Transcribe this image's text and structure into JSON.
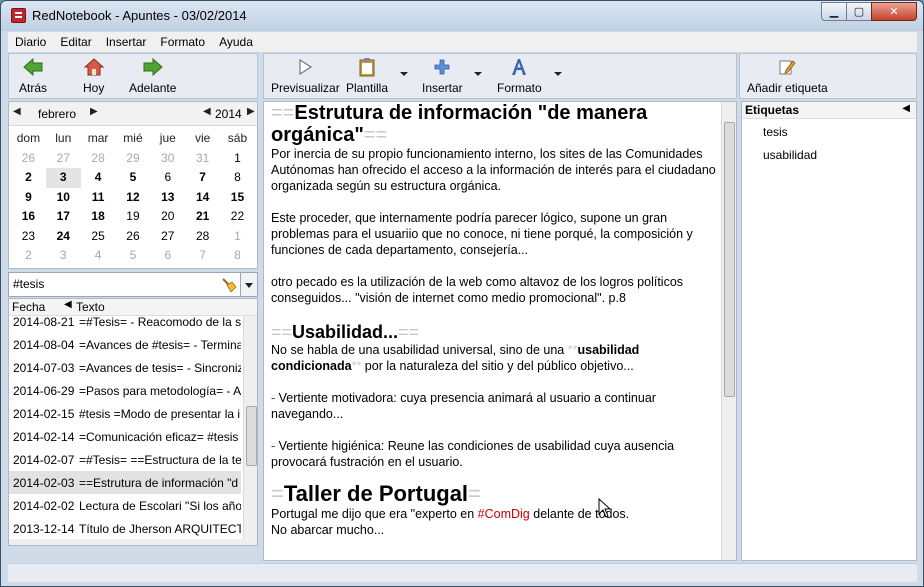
{
  "window": {
    "title": "RedNotebook - Apuntes - 03/02/2014",
    "buttons": {
      "minimize": "▁",
      "maximize": "▢",
      "close": "✕"
    }
  },
  "menu": [
    "Diario",
    "Editar",
    "Insertar",
    "Formato",
    "Ayuda"
  ],
  "nav_toolbar": {
    "back": "Atrás",
    "today": "Hoy",
    "forward": "Adelante"
  },
  "edit_toolbar": {
    "preview": "Previsualizar",
    "template": "Plantilla",
    "insert": "Insertar",
    "format": "Formato"
  },
  "tag_toolbar": {
    "add_tag": "Añadir etiqueta"
  },
  "calendar": {
    "month": "febrero",
    "year": "2014",
    "weekdays": [
      "dom",
      "lun",
      "mar",
      "mié",
      "jue",
      "vie",
      "sáb"
    ],
    "weeks": [
      [
        {
          "d": "26",
          "s": "dim"
        },
        {
          "d": "27",
          "s": "dim"
        },
        {
          "d": "28",
          "s": "dim"
        },
        {
          "d": "29",
          "s": "dim"
        },
        {
          "d": "30",
          "s": "dim"
        },
        {
          "d": "31",
          "s": "dim"
        },
        {
          "d": "1",
          "s": ""
        }
      ],
      [
        {
          "d": "2",
          "s": "bold"
        },
        {
          "d": "3",
          "s": "bold sel"
        },
        {
          "d": "4",
          "s": "bold"
        },
        {
          "d": "5",
          "s": "bold"
        },
        {
          "d": "6",
          "s": ""
        },
        {
          "d": "7",
          "s": "bold"
        },
        {
          "d": "8",
          "s": ""
        }
      ],
      [
        {
          "d": "9",
          "s": "bold"
        },
        {
          "d": "10",
          "s": "bold"
        },
        {
          "d": "11",
          "s": "bold"
        },
        {
          "d": "12",
          "s": "bold"
        },
        {
          "d": "13",
          "s": "bold"
        },
        {
          "d": "14",
          "s": "bold"
        },
        {
          "d": "15",
          "s": "bold"
        }
      ],
      [
        {
          "d": "16",
          "s": "bold"
        },
        {
          "d": "17",
          "s": "bold"
        },
        {
          "d": "18",
          "s": "bold"
        },
        {
          "d": "19",
          "s": ""
        },
        {
          "d": "20",
          "s": ""
        },
        {
          "d": "21",
          "s": "bold"
        },
        {
          "d": "22",
          "s": ""
        }
      ],
      [
        {
          "d": "23",
          "s": ""
        },
        {
          "d": "24",
          "s": "bold"
        },
        {
          "d": "25",
          "s": ""
        },
        {
          "d": "26",
          "s": ""
        },
        {
          "d": "27",
          "s": ""
        },
        {
          "d": "28",
          "s": ""
        },
        {
          "d": "1",
          "s": "dim"
        }
      ],
      [
        {
          "d": "2",
          "s": "dim"
        },
        {
          "d": "3",
          "s": "dim"
        },
        {
          "d": "4",
          "s": "dim"
        },
        {
          "d": "5",
          "s": "dim"
        },
        {
          "d": "6",
          "s": "dim"
        },
        {
          "d": "7",
          "s": "dim"
        },
        {
          "d": "8",
          "s": "dim"
        }
      ]
    ]
  },
  "search": {
    "value": "#tesis"
  },
  "results": {
    "col_date": "Fecha",
    "col_text": "Texto",
    "rows": [
      {
        "date": "2014-08-21",
        "text": "=#Tesis= - Reacomodo de la si"
      },
      {
        "date": "2014-08-04",
        "text": "=Avances de #tesis= - Termina"
      },
      {
        "date": "2014-07-03",
        "text": "=Avances de tesis= - Sincroniz"
      },
      {
        "date": "2014-06-29",
        "text": "=Pasos para metodología= - A"
      },
      {
        "date": "2014-02-15",
        "text": "#tesis =Modo de presentar la ir"
      },
      {
        "date": "2014-02-14",
        "text": "=Comunicación eficaz= #tesis"
      },
      {
        "date": "2014-02-07",
        "text": "=#Tesis= ==Estructura de la te"
      },
      {
        "date": "2014-02-03",
        "text": "==Estrutura de información \"d"
      },
      {
        "date": "2014-02-02",
        "text": "Lectura de Escolari  \"Si los años"
      },
      {
        "date": "2013-12-14",
        "text": "Título de Jherson  ARQUITECTU"
      }
    ],
    "selected_index": 7
  },
  "editor": {
    "h1a_mark": "==",
    "h1a": "Estrutura de información \"de manera orgánica\"",
    "p1": "Por inercia de su propio funcionamiento interno, los sites de las Comunidades Autónomas han ofrecido el acceso a la información de interés para el ciudadano organizada según su estructura orgánica.",
    "p2": "Este proceder, que internamente podría parecer lógico, supone un gran problemas para el usuariio que no conoce, ni tiene porqué, la composición y funciones de cada departamento, consejería...",
    "p3": "otro pecado es la utilización de la web como altavoz de los logros políticos conseguidos... \"visión de internet como medio promocional\". p.8",
    "h2_mark": "==",
    "h2": "Usabilidad...",
    "p4_a": "No se habla de una usabilidad universal, sino de una ",
    "p4_mark": "**",
    "p4_b": "usabilidad condicionada",
    "p4_c": " por la naturaleza del sitio y del público objetivo...",
    "dash": "- ",
    "p5": "Vertiente motivadora:        cuya  presencia animará al usuario a continuar navegando...",
    "p6": "Vertiente higiénica: Reune las condiciones de usabilidad cuya ausencia provocará fustración en el usuario.",
    "h1b_mark": "=",
    "h1b": "Taller de Portugal",
    "p7_a": "Portugal me dijo que era \"experto en ",
    "p7_tag": "#ComDig",
    "p7_b": " delante de todos.",
    "p8": "No abarcar mucho..."
  },
  "tags_panel": {
    "header": "Etiquetas",
    "items": [
      "tesis",
      "usabilidad"
    ]
  },
  "colors": {
    "accent_red": "#cc0000",
    "markup_gray": "#c8c8c8",
    "selection": "#e2e2e2"
  }
}
